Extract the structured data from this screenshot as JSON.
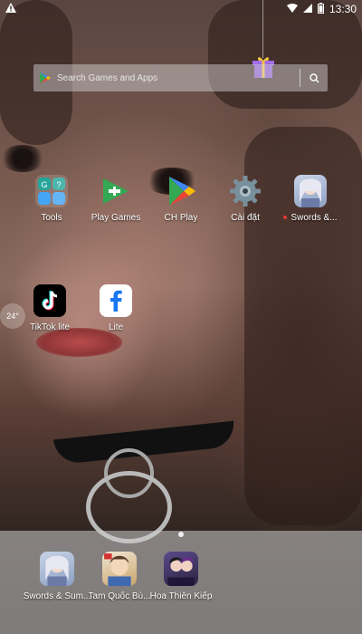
{
  "status_bar": {
    "time": "13:30"
  },
  "search": {
    "placeholder": "Search Games and Apps"
  },
  "home_apps": [
    {
      "label": "Tools",
      "icon": "tools-folder-icon"
    },
    {
      "label": "Play Games",
      "icon": "play-games-icon"
    },
    {
      "label": "CH Play",
      "icon": "google-play-icon"
    },
    {
      "label": "Cài đặt",
      "icon": "settings-gear-icon"
    },
    {
      "label": "Swords &...",
      "icon": "swords-game-icon",
      "unread": true
    },
    {
      "label": "TikTok lite",
      "icon": "tiktok-icon"
    },
    {
      "label": "Lite",
      "icon": "facebook-lite-icon"
    }
  ],
  "weather": {
    "temp": "24°"
  },
  "dock_apps": [
    {
      "label": "Swords & Sum...",
      "icon": "swords-game-icon"
    },
    {
      "label": "Tam Quốc Bù...",
      "icon": "tam-quoc-game-icon"
    },
    {
      "label": "Hoa Thiên Kiếp",
      "icon": "hoa-thien-kiep-icon"
    }
  ],
  "colors": {
    "accent_play_green": "#34a853",
    "notification_dot": "#e53935"
  }
}
